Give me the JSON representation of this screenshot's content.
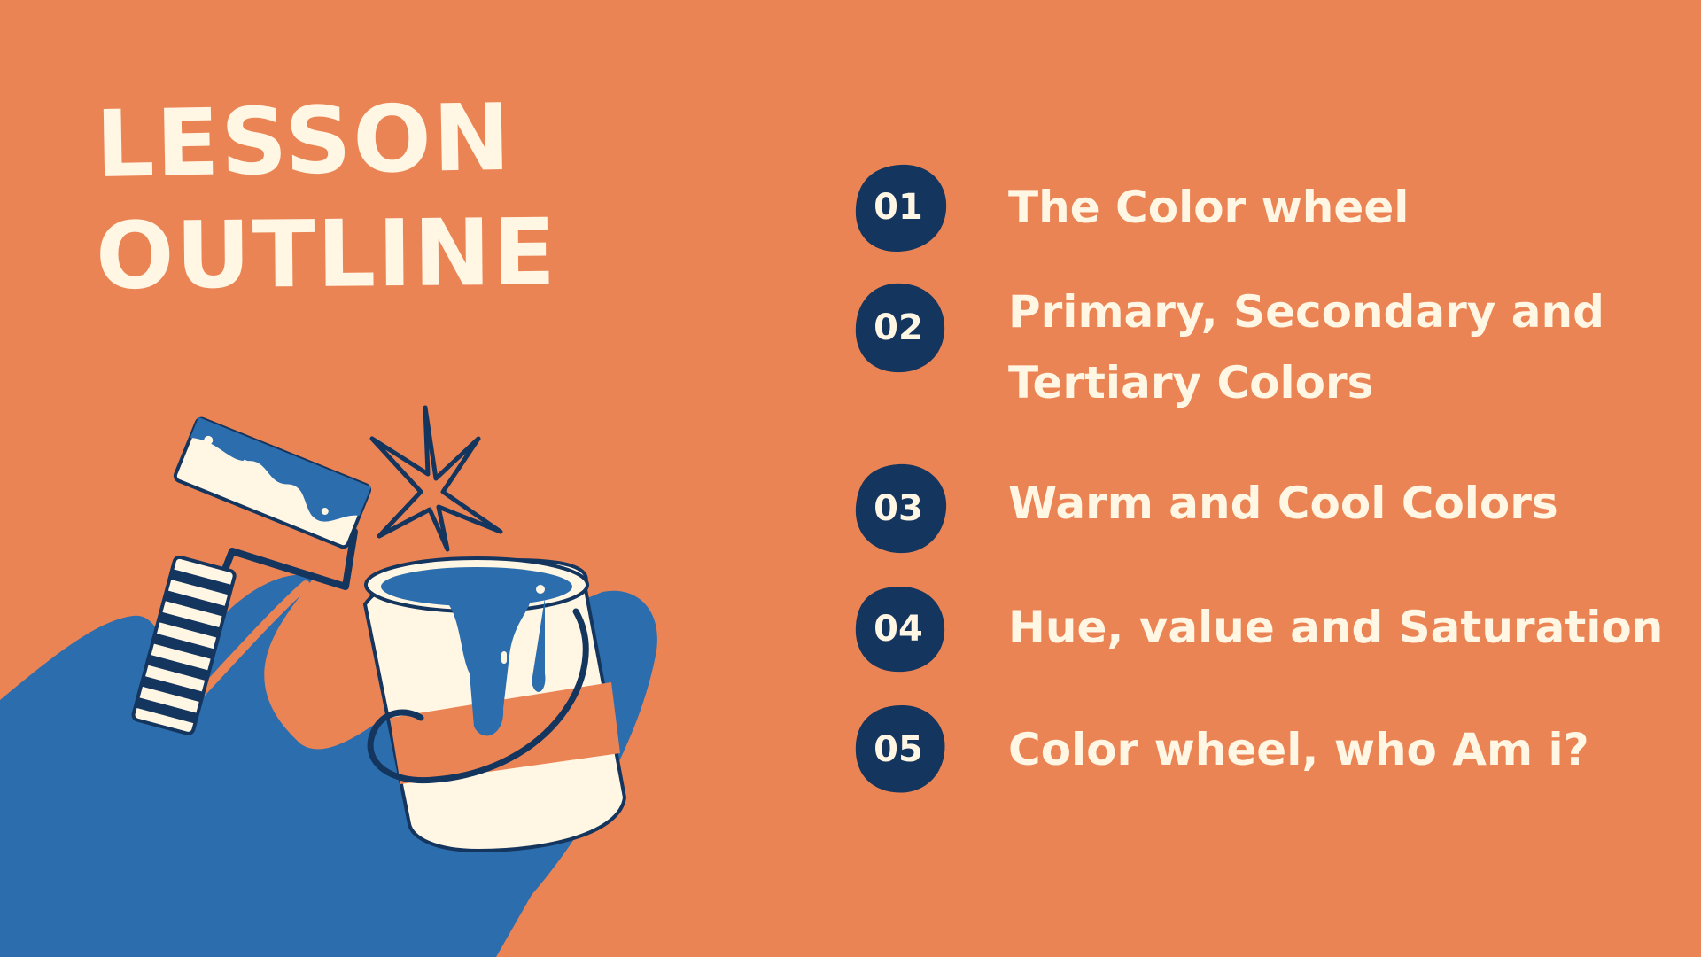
{
  "title": {
    "line1": "LESSON",
    "line2": "OUTLINE"
  },
  "colors": {
    "background": "#EB8455",
    "cream": "#FFF6E4",
    "navy": "#14355E",
    "blue": "#2C6DAE"
  },
  "outline": [
    {
      "number": "01",
      "label": "The Color wheel"
    },
    {
      "number": "02",
      "label_line1": "Primary, Secondary and",
      "label_line2": "Tertiary Colors"
    },
    {
      "number": "03",
      "label": "Warm and Cool Colors"
    },
    {
      "number": "04",
      "label": "Hue, value and Saturation"
    },
    {
      "number": "05",
      "label": "Color wheel, who Am i?"
    }
  ],
  "illustration": {
    "icons": [
      "paint-roller-icon",
      "paint-bucket-icon",
      "sparkle-icon",
      "hand-icon"
    ]
  }
}
